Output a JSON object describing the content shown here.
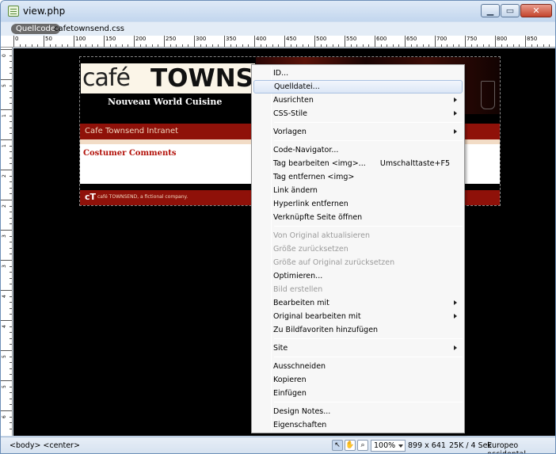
{
  "window": {
    "title": "view.php"
  },
  "tabs": {
    "source": "Quellcode",
    "file": "cafetownsend.css"
  },
  "ruler": {
    "top_labels": [
      "0",
      "50",
      "100",
      "150",
      "200",
      "250",
      "300",
      "350",
      "400",
      "450",
      "500",
      "550",
      "600",
      "650",
      "700",
      "750",
      "800",
      "850"
    ],
    "left_labels": [
      "0",
      "5",
      "1",
      "1",
      "2",
      "2",
      "3",
      "3",
      "4",
      "4",
      "5",
      "5",
      "6",
      "6"
    ]
  },
  "site": {
    "logo_cafe": "café",
    "logo_towns": "TOWNS",
    "tagline": "Nouveau World Cuisine",
    "nav_text": "Cafe Townsend Intranet",
    "content_title": "Costumer Comments",
    "footer_logo": "cT",
    "footer_text": "café TOWNSEND, a fictional company."
  },
  "context_menu": {
    "items": [
      {
        "label": "ID...",
        "disabled": false,
        "submenu": false
      },
      {
        "label": "Quelldatei...",
        "disabled": false,
        "submenu": false,
        "hover": true
      },
      {
        "label": "Ausrichten",
        "disabled": false,
        "submenu": true
      },
      {
        "label": "CSS-Stile",
        "disabled": false,
        "submenu": true
      },
      {
        "label": "Vorlagen",
        "disabled": false,
        "submenu": true
      },
      {
        "label": "Code-Navigator...",
        "disabled": false,
        "submenu": false
      },
      {
        "label": "Tag bearbeiten <img>...",
        "disabled": false,
        "submenu": false,
        "shortcut": "Umschalttaste+F5"
      },
      {
        "label": "Tag entfernen <img>",
        "disabled": false,
        "submenu": false
      },
      {
        "label": "Link ändern",
        "disabled": false,
        "submenu": false
      },
      {
        "label": "Hyperlink entfernen",
        "disabled": false,
        "submenu": false
      },
      {
        "label": "Verknüpfte Seite öffnen",
        "disabled": false,
        "submenu": false
      },
      {
        "label": "Von Original aktualisieren",
        "disabled": true,
        "submenu": false
      },
      {
        "label": "Größe zurücksetzen",
        "disabled": true,
        "submenu": false
      },
      {
        "label": "Größe auf Original zurücksetzen",
        "disabled": true,
        "submenu": false
      },
      {
        "label": "Optimieren...",
        "disabled": false,
        "submenu": false
      },
      {
        "label": "Bild erstellen",
        "disabled": true,
        "submenu": false
      },
      {
        "label": "Bearbeiten mit",
        "disabled": false,
        "submenu": true
      },
      {
        "label": "Original bearbeiten mit",
        "disabled": false,
        "submenu": true
      },
      {
        "label": "Zu Bildfavoriten hinzufügen",
        "disabled": false,
        "submenu": false
      },
      {
        "label": "Site",
        "disabled": false,
        "submenu": true
      },
      {
        "label": "Ausschneiden",
        "disabled": false,
        "submenu": false
      },
      {
        "label": "Kopieren",
        "disabled": false,
        "submenu": false
      },
      {
        "label": "Einfügen",
        "disabled": false,
        "submenu": false
      },
      {
        "label": "Design Notes...",
        "disabled": false,
        "submenu": false
      },
      {
        "label": "Eigenschaften",
        "disabled": false,
        "submenu": false
      }
    ]
  },
  "statusbar": {
    "tag_selector": "<body> <center>",
    "zoom": "100%",
    "dimensions": "899 x 641",
    "download": "25K / 4 Sek",
    "encoding": "Europeo occidental"
  },
  "colors": {
    "accent": "#8f1109",
    "menu_hover": "#dce7f6"
  }
}
